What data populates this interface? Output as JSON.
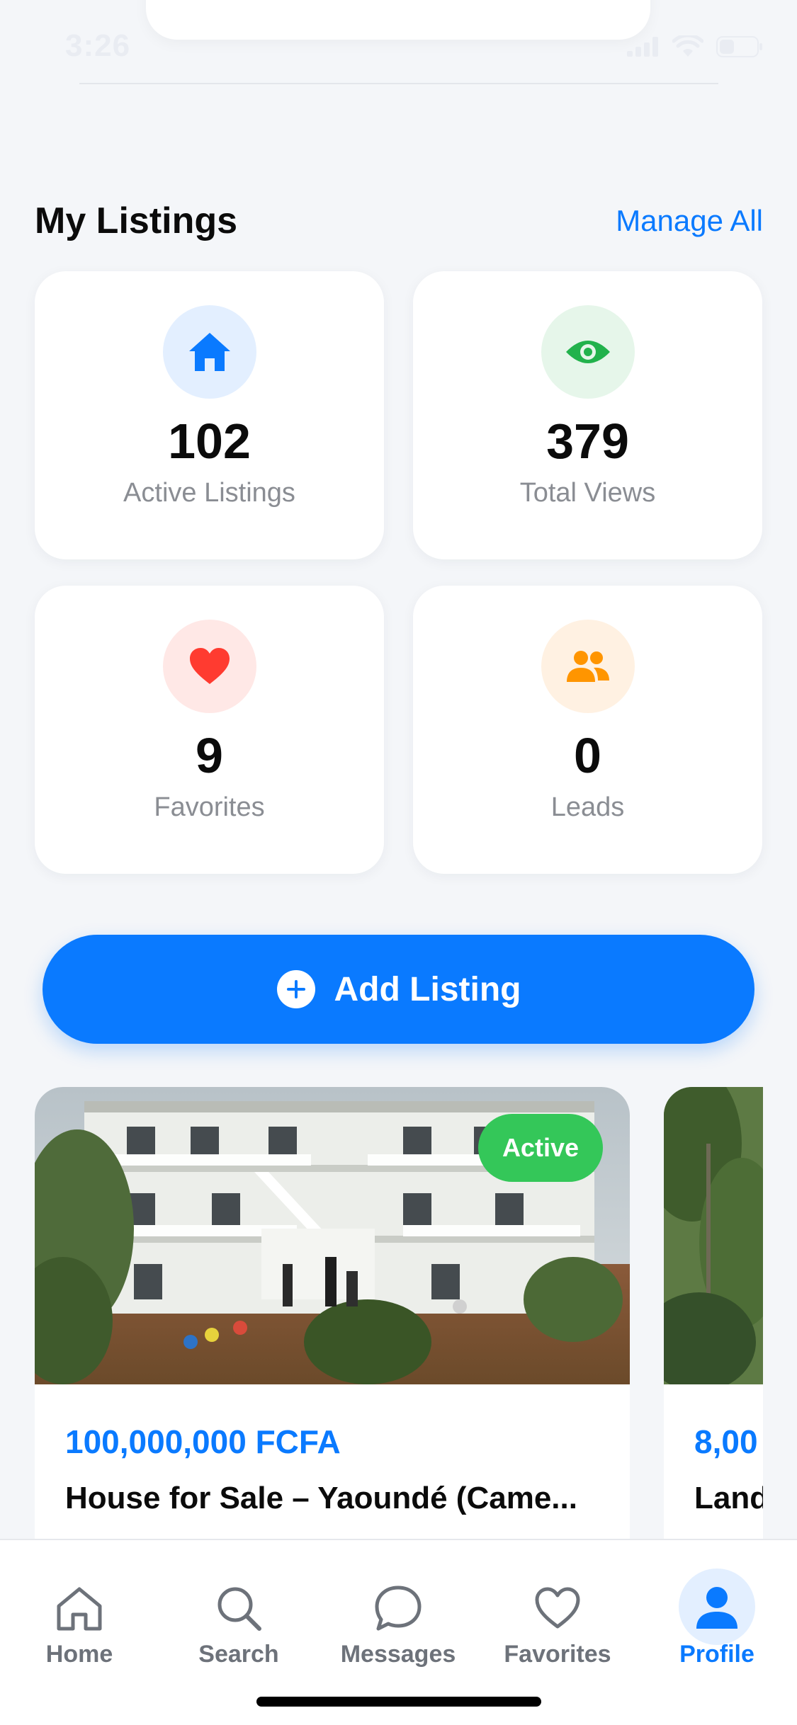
{
  "status_bar": {
    "time": "3:26"
  },
  "section": {
    "title": "My Listings",
    "manage_all": "Manage All"
  },
  "stats": [
    {
      "icon": "home-icon",
      "value": "102",
      "label": "Active Listings",
      "color": "#0a7aff",
      "bg": "#e3efff"
    },
    {
      "icon": "eye-icon",
      "value": "379",
      "label": "Total Views",
      "color": "#22b24c",
      "bg": "#e6f6ea"
    },
    {
      "icon": "heart-icon",
      "value": "9",
      "label": "Favorites",
      "color": "#ff3b30",
      "bg": "#ffe8e6"
    },
    {
      "icon": "people-icon",
      "value": "0",
      "label": "Leads",
      "color": "#ff9500",
      "bg": "#fff1e2"
    }
  ],
  "add_listing": {
    "label": "Add Listing"
  },
  "listings": [
    {
      "status": "Active",
      "price": "100,000,000 FCFA",
      "title": "House for Sale – Yaoundé (Came..."
    },
    {
      "price": "8,00",
      "title": "Land"
    }
  ],
  "tabs": [
    {
      "label": "Home",
      "icon": "house-outline-icon",
      "active": false
    },
    {
      "label": "Search",
      "icon": "magnifier-icon",
      "active": false
    },
    {
      "label": "Messages",
      "icon": "chat-bubble-icon",
      "active": false
    },
    {
      "label": "Favorites",
      "icon": "heart-outline-icon",
      "active": false
    },
    {
      "label": "Profile",
      "icon": "person-icon",
      "active": true
    }
  ],
  "colors": {
    "accent": "#0a7aff",
    "background": "#f4f6f9",
    "active_badge": "#34c759"
  }
}
